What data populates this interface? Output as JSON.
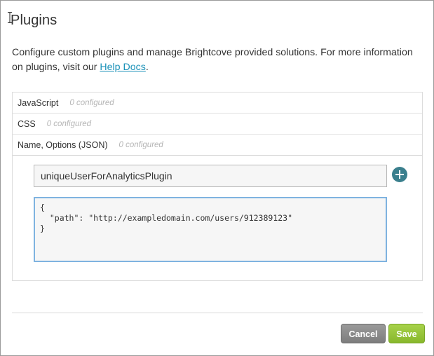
{
  "dialog": {
    "title": "Plugins",
    "description": "Configure custom plugins and manage Brightcove provided solutions. For more information on plugins, visit our ",
    "help_link": "Help Docs",
    "description_end": "."
  },
  "sections": [
    {
      "label": "JavaScript",
      "count": "0 configured"
    },
    {
      "label": "CSS",
      "count": "0 configured"
    },
    {
      "label": "Name, Options (JSON)",
      "count": "0 configured"
    }
  ],
  "plugin_form": {
    "name_value": "uniqueUserForAnalyticsPlugin",
    "options_value": "{\n  \"path\": \"http://exampledomain.com/users/912389123\"\n}"
  },
  "footer": {
    "cancel_label": "Cancel",
    "save_label": "Save"
  },
  "colors": {
    "link": "#1a91b8",
    "add_button": "#3a7f8d",
    "save": "#94c43a",
    "cancel": "#8a8a8a",
    "focus_border": "#7fb3e0"
  }
}
